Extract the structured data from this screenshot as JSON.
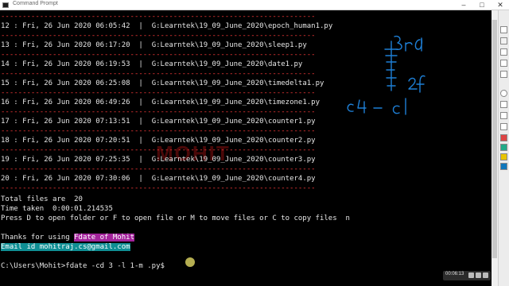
{
  "window": {
    "title": "Command Prompt",
    "minimize": "–",
    "maximize": "□",
    "close": "✕"
  },
  "separator": "-------------------------------------------------------------------------",
  "files": [
    {
      "idx": "12",
      "dow": "Fri",
      "datetime": "26 Jun 2020 06:05:42",
      "path": "G:Learntek\\19_09_June_2020\\epoch_human1.py"
    },
    {
      "idx": "13",
      "dow": "Fri",
      "datetime": "26 Jun 2020 06:17:20",
      "path": "G:Learntek\\19_09_June_2020\\sleep1.py"
    },
    {
      "idx": "14",
      "dow": "Fri",
      "datetime": "26 Jun 2020 06:19:53",
      "path": "G:Learntek\\19_09_June_2020\\date1.py"
    },
    {
      "idx": "15",
      "dow": "Fri",
      "datetime": "26 Jun 2020 06:25:08",
      "path": "G:Learntek\\19_09_June_2020\\timedelta1.py"
    },
    {
      "idx": "16",
      "dow": "Fri",
      "datetime": "26 Jun 2020 06:49:26",
      "path": "G:Learntek\\19_09_June_2020\\timezone1.py"
    },
    {
      "idx": "17",
      "dow": "Fri",
      "datetime": "26 Jun 2020 07:13:51",
      "path": "G:Learntek\\19_09_June_2020\\counter1.py"
    },
    {
      "idx": "18",
      "dow": "Fri",
      "datetime": "26 Jun 2020 07:20:51",
      "path": "G:Learntek\\19_09_June_2020\\counter2.py"
    },
    {
      "idx": "19",
      "dow": "Fri",
      "datetime": "26 Jun 2020 07:25:35",
      "path": "G:Learntek\\19_09_June_2020\\counter3.py"
    },
    {
      "idx": "20",
      "dow": "Fri",
      "datetime": "26 Jun 2020 07:30:06",
      "path": "G:Learntek\\19_09_June_2020\\counter4.py"
    }
  ],
  "summary": {
    "total_files": "Total files are  20",
    "time_taken": "Time taken  0:00:01.214535",
    "prompt_help": "Press D to open folder or F to open file or M to move files or C to copy files  n"
  },
  "thanks": {
    "prefix": "Thanks for using ",
    "product": "Fdate of Mohit",
    "email": "Email id mohitraj.cs@gmail.com"
  },
  "command_line": "C:\\Users\\Mohit>fdate -cd 3 -l 1-m .py$",
  "watermark": "MOHIT",
  "annotation": {
    "label_top": "3rd",
    "label_mid": "2f",
    "label_bottom": "C4 - C1",
    "ink_color": "#1e7fd6"
  },
  "player": {
    "time": "00:06:13"
  },
  "colors": {
    "separator": "#ff3b3b",
    "highlight_product": "#a3239b",
    "highlight_email": "#0f8f94"
  }
}
